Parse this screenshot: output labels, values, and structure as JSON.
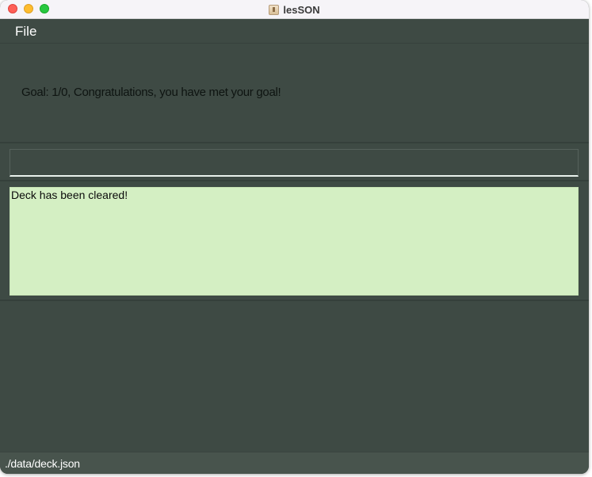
{
  "window": {
    "title": "lesSON"
  },
  "menubar": {
    "file_label": "File"
  },
  "goal_panel": {
    "text": "Goal: 1/0, Congratulations, you have met your goal!"
  },
  "command_box": {
    "value": "",
    "placeholder": ""
  },
  "result_display": {
    "text": "Deck has been cleared!"
  },
  "status_bar": {
    "path": "./data/deck.json"
  },
  "colors": {
    "window_background": "#3e4a44",
    "result_background": "#d4efc3",
    "status_background": "#48544d"
  }
}
